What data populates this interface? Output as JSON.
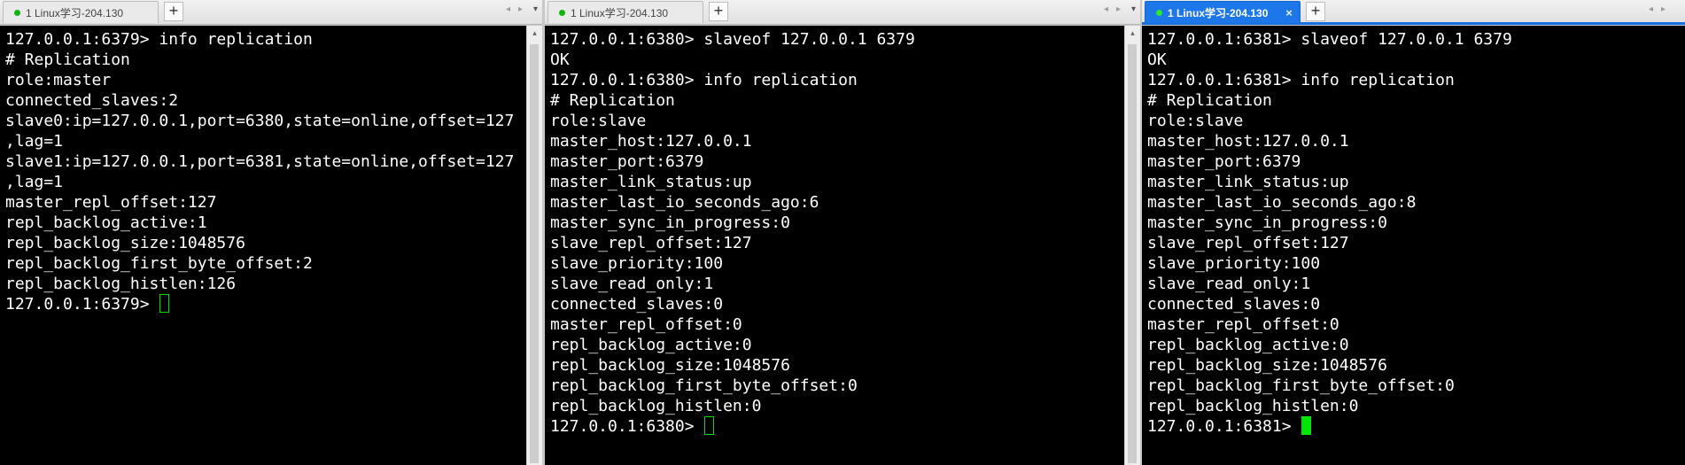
{
  "tab_title": "1 Linux学习-204.130",
  "new_tab_label": "+",
  "close_glyph": "×",
  "prev_glyph": "◂",
  "next_glyph": "▸",
  "menu_glyph": "▾",
  "scroll_up_glyph": "▴",
  "colors": {
    "active_tab": "#1e77e8",
    "status_dot": "#12b312",
    "cursor": "#00e600",
    "terminal_bg": "#000000"
  },
  "panes": [
    {
      "lines": [
        "127.0.0.1:6379> info replication",
        "# Replication",
        "role:master",
        "connected_slaves:2",
        "slave0:ip=127.0.0.1,port=6380,state=online,offset=127",
        ",lag=1",
        "slave1:ip=127.0.0.1,port=6381,state=online,offset=127",
        ",lag=1",
        "master_repl_offset:127",
        "repl_backlog_active:1",
        "repl_backlog_size:1048576",
        "repl_backlog_first_byte_offset:2",
        "repl_backlog_histlen:126"
      ],
      "prompt": "127.0.0.1:6379> "
    },
    {
      "lines": [
        "127.0.0.1:6380> slaveof 127.0.0.1 6379",
        "OK",
        "127.0.0.1:6380> info replication",
        "# Replication",
        "role:slave",
        "master_host:127.0.0.1",
        "master_port:6379",
        "master_link_status:up",
        "master_last_io_seconds_ago:6",
        "master_sync_in_progress:0",
        "slave_repl_offset:127",
        "slave_priority:100",
        "slave_read_only:1",
        "connected_slaves:0",
        "master_repl_offset:0",
        "repl_backlog_active:0",
        "repl_backlog_size:1048576",
        "repl_backlog_first_byte_offset:0",
        "repl_backlog_histlen:0"
      ],
      "prompt": "127.0.0.1:6380> "
    },
    {
      "lines": [
        "127.0.0.1:6381> slaveof 127.0.0.1 6379",
        "OK",
        "127.0.0.1:6381> info replication",
        "# Replication",
        "role:slave",
        "master_host:127.0.0.1",
        "master_port:6379",
        "master_link_status:up",
        "master_last_io_seconds_ago:8",
        "master_sync_in_progress:0",
        "slave_repl_offset:127",
        "slave_priority:100",
        "slave_read_only:1",
        "connected_slaves:0",
        "master_repl_offset:0",
        "repl_backlog_active:0",
        "repl_backlog_size:1048576",
        "repl_backlog_first_byte_offset:0",
        "repl_backlog_histlen:0"
      ],
      "prompt": "127.0.0.1:6381> "
    }
  ]
}
